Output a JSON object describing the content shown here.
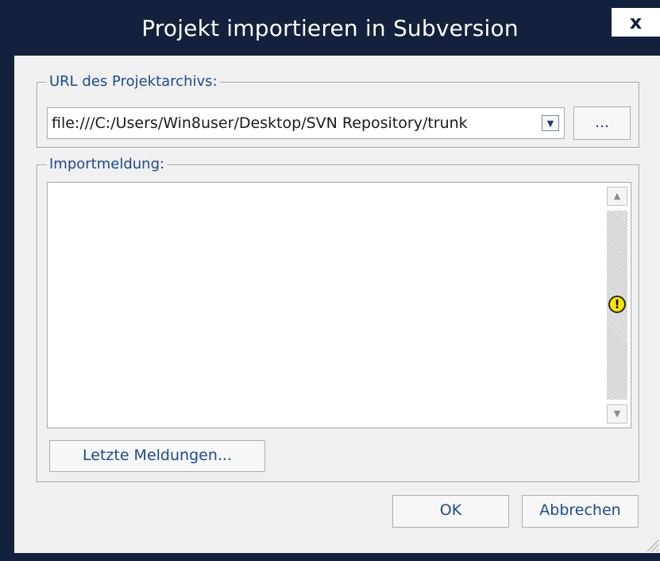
{
  "window": {
    "title": "Projekt importieren in Subversion",
    "close_glyph": "x"
  },
  "url_group": {
    "label": "URL des Projektarchivs:",
    "url_value": "file:///C:/Users/Win8user/Desktop/SVN Repository/trunk",
    "browse_label": "..."
  },
  "message_group": {
    "label": "Importmeldung:",
    "message_text": "",
    "recent_messages_label": "Letzte Meldungen..."
  },
  "buttons": {
    "ok_label": "OK",
    "cancel_label": "Abbrechen"
  },
  "icons": {
    "close": "close-icon",
    "dropdown": "chevron-down-icon",
    "scroll_up": "scroll-up-arrow-icon",
    "scroll_down": "scroll-down-arrow-icon",
    "warning": "warning-icon",
    "resize": "resize-grip-icon"
  },
  "colors": {
    "titlebar": "#13213d",
    "label_text": "#1b4b8f",
    "warning": "#ffe600"
  }
}
